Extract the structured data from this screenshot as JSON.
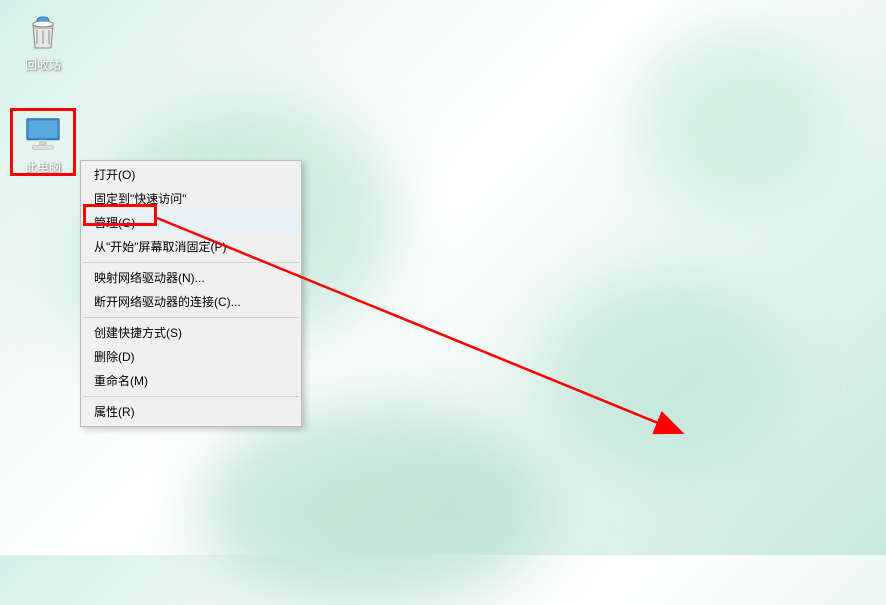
{
  "desktop": {
    "icons": {
      "recycle_bin": {
        "label": "回收站"
      },
      "this_pc": {
        "label": "此电脑"
      }
    }
  },
  "context_menu": {
    "items": [
      {
        "label": "打开(O)",
        "separator_after": false
      },
      {
        "label": "固定到\"快速访问\"",
        "separator_after": false
      },
      {
        "label": "管理(G)",
        "separator_after": false,
        "highlighted": true
      },
      {
        "label": "从\"开始\"屏幕取消固定(P)",
        "separator_after": true
      },
      {
        "label": "映射网络驱动器(N)...",
        "separator_after": false
      },
      {
        "label": "断开网络驱动器的连接(C)...",
        "separator_after": true
      },
      {
        "label": "创建快捷方式(S)",
        "separator_after": false
      },
      {
        "label": "删除(D)",
        "separator_after": false
      },
      {
        "label": "重命名(M)",
        "separator_after": true
      },
      {
        "label": "属性(R)",
        "separator_after": false
      }
    ]
  },
  "annotations": {
    "highlight_this_pc": true,
    "highlight_manage": true,
    "arrow_from_manage": true
  }
}
